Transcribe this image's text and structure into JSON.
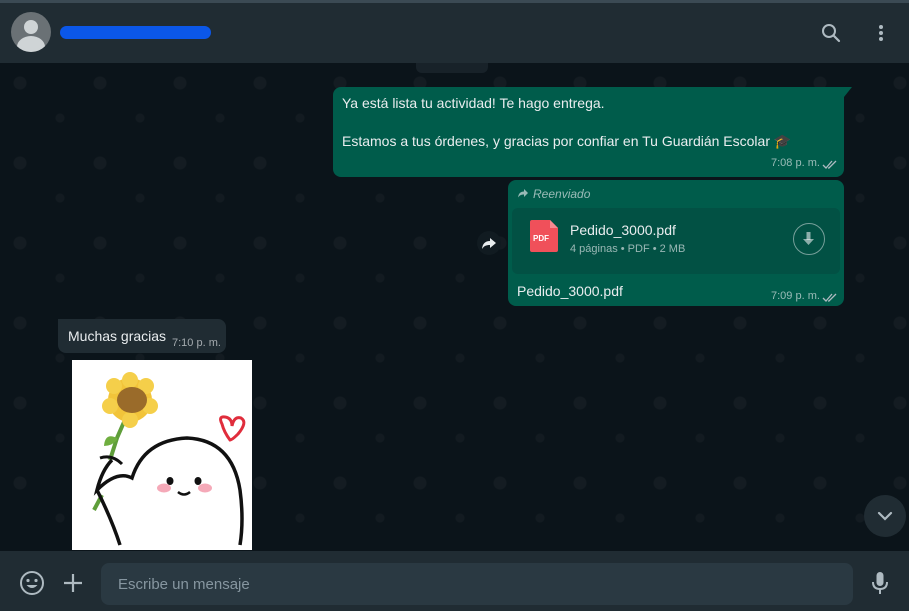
{
  "header": {
    "contact_name_redacted": true,
    "search_icon": "search-icon",
    "menu_icon": "kebab-menu-icon"
  },
  "messages": {
    "m1": {
      "line1": "Ya está lista tu actividad! Te hago entrega.",
      "line2": "Estamos a tus órdenes, y gracias por confiar en Tu Guardián Escolar 🎓",
      "time": "7:08 p. m."
    },
    "m2": {
      "forwarded_label": "Reenviado",
      "file_name": "Pedido_3000.pdf",
      "file_meta": "4 páginas • PDF • 2 MB",
      "pdf_badge": "PDF",
      "caption": "Pedido_3000.pdf",
      "time": "7:09 p. m."
    },
    "m3": {
      "text": "Muchas gracias",
      "time": "7:10 p. m."
    }
  },
  "footer": {
    "placeholder": "Escribe un mensaje"
  },
  "colors": {
    "outgoing_bubble": "#005c4b",
    "incoming_bubble": "#202c33",
    "background": "#0b141a",
    "pdf_red": "#f0505a",
    "redaction_blue": "#0b57e8"
  }
}
